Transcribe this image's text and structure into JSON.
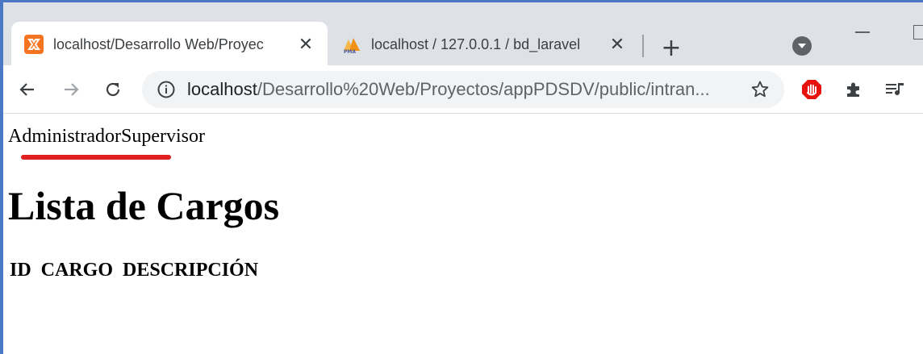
{
  "browser": {
    "tabs": [
      {
        "title": "localhost/Desarrollo Web/Proyec",
        "favicon": "xampp-icon",
        "active": true
      },
      {
        "title": "localhost / 127.0.0.1 / bd_laravel",
        "favicon": "phpmyadmin-icon",
        "active": false
      }
    ],
    "new_tab_label": "+",
    "close_glyph": "✕",
    "address": {
      "host": "localhost",
      "path": "/Desarrollo%20Web/Proyectos/appPDSDV/public/intran..."
    },
    "colors": {
      "tabstrip": "#dee1e6",
      "omnibox": "#f1f3f4",
      "frame": "#4a78c4",
      "annotation": "#e02020"
    }
  },
  "page": {
    "roles": [
      "Administrador",
      "Supervisor"
    ],
    "title": "Lista de Cargos",
    "table_headers": [
      "ID",
      "CARGO",
      "DESCRIPCIÓN"
    ]
  }
}
